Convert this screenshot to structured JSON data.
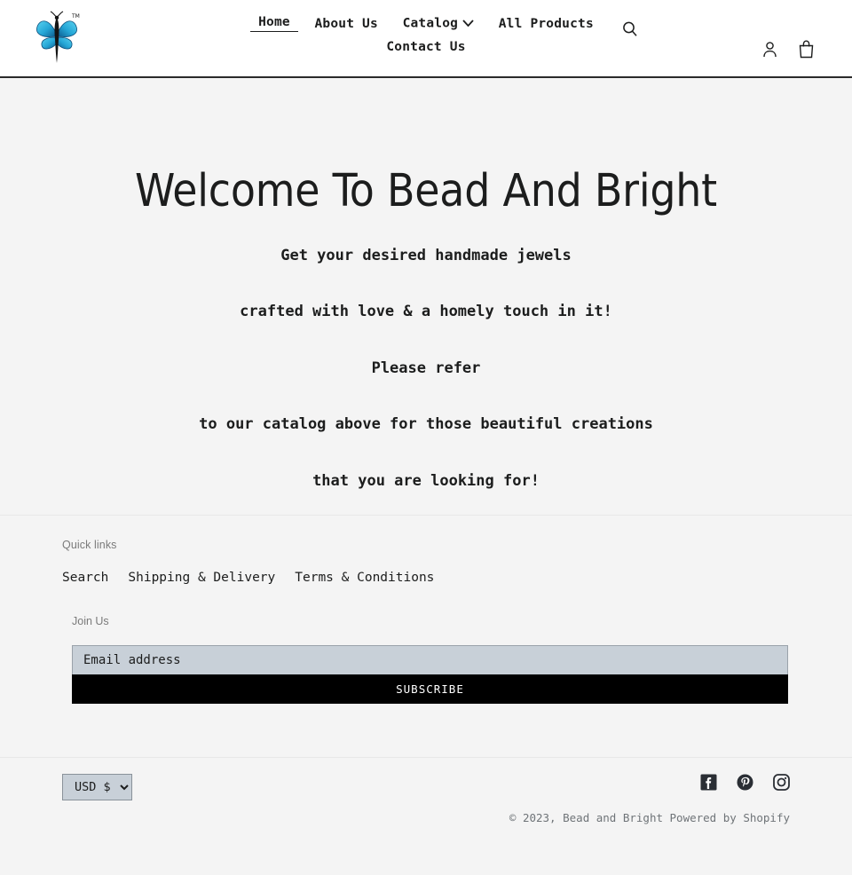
{
  "header": {
    "logo_alt": "Bead and Bright butterfly logo",
    "logo_trademark": "TM",
    "nav_rows": [
      [
        {
          "label": "Home",
          "active": true,
          "caret": false
        },
        {
          "label": "About Us",
          "active": false,
          "caret": false
        },
        {
          "label": "Catalog",
          "active": false,
          "caret": true
        },
        {
          "label": "All Products",
          "active": false,
          "caret": false
        }
      ],
      [
        {
          "label": "Contact Us",
          "active": false,
          "caret": false
        }
      ]
    ],
    "icons": {
      "search": "search-icon",
      "account": "account-icon",
      "cart": "cart-icon"
    }
  },
  "hero": {
    "title": "Welcome To Bead And Bright",
    "lines": [
      "Get your desired handmade jewels",
      "crafted with love & a homely touch in it!",
      "Please refer",
      "to our catalog above for those beautiful creations",
      "that you are looking for!"
    ]
  },
  "footer": {
    "quick_links_label": "Quick links",
    "quick_links": [
      {
        "label": "Search"
      },
      {
        "label": "Shipping & Delivery"
      },
      {
        "label": "Terms & Conditions"
      }
    ],
    "join_label": "Join Us",
    "email_placeholder": "Email address",
    "email_value": "",
    "subscribe_label": "SUBSCRIBE",
    "currency": {
      "selected": "USD $",
      "options": [
        "USD $"
      ]
    },
    "social": [
      {
        "name": "facebook",
        "label": "Facebook"
      },
      {
        "name": "pinterest",
        "label": "Pinterest"
      },
      {
        "name": "instagram",
        "label": "Instagram"
      }
    ],
    "copyright": "© 2023, Bead and Bright",
    "powered_by": "Powered by Shopify"
  },
  "colors": {
    "page_bg": "#f4f4f4",
    "header_bg": "#ffffff",
    "text": "#1c1d1d",
    "muted": "#7a7a7a",
    "input_bg": "#c8d0d8",
    "button_bg": "#000000",
    "logo_blue": "#29a8d8"
  }
}
